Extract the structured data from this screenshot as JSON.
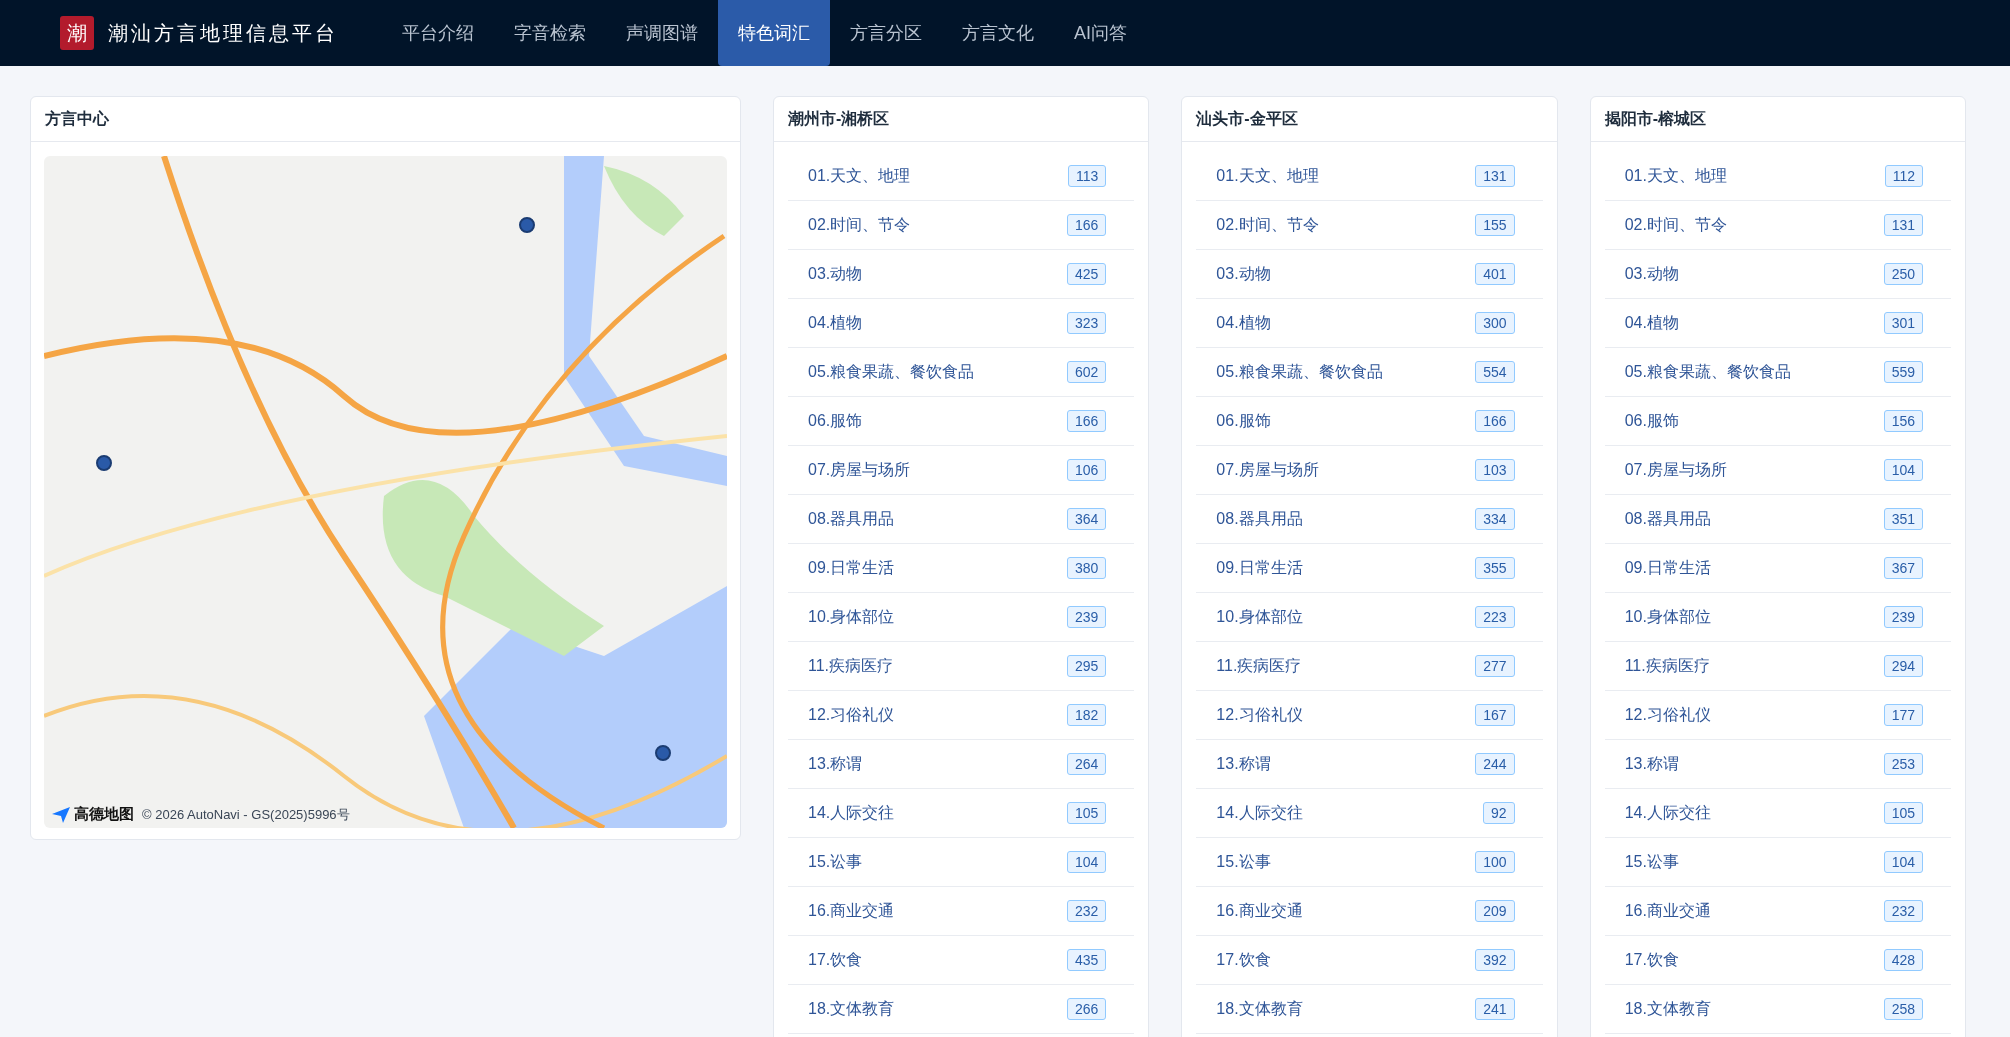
{
  "header": {
    "logo": "潮",
    "title": "潮汕方言地理信息平台",
    "nav": [
      {
        "label": "平台介绍",
        "selected": false
      },
      {
        "label": "字音检索",
        "selected": false
      },
      {
        "label": "声调图谱",
        "selected": false
      },
      {
        "label": "特色词汇",
        "selected": true
      },
      {
        "label": "方言分区",
        "selected": false
      },
      {
        "label": "方言文化",
        "selected": false
      },
      {
        "label": "AI问答",
        "selected": false
      }
    ]
  },
  "map_card": {
    "title": "方言中心",
    "map_logo": "高德地图",
    "attribution": "© 2026 AutoNavi - GS(2025)5996号"
  },
  "districts": [
    {
      "title": "潮州市-湘桥区",
      "items": [
        {
          "label": "01.天文、地理",
          "count": "113"
        },
        {
          "label": "02.时间、节令",
          "count": "166"
        },
        {
          "label": "03.动物",
          "count": "425"
        },
        {
          "label": "04.植物",
          "count": "323"
        },
        {
          "label": "05.粮食果蔬、餐饮食品",
          "count": "602"
        },
        {
          "label": "06.服饰",
          "count": "166"
        },
        {
          "label": "07.房屋与场所",
          "count": "106"
        },
        {
          "label": "08.器具用品",
          "count": "364"
        },
        {
          "label": "09.日常生活",
          "count": "380"
        },
        {
          "label": "10.身体部位",
          "count": "239"
        },
        {
          "label": "11.疾病医疗",
          "count": "295"
        },
        {
          "label": "12.习俗礼仪",
          "count": "182"
        },
        {
          "label": "13.称谓",
          "count": "264"
        },
        {
          "label": "14.人际交往",
          "count": "105"
        },
        {
          "label": "15.讼事",
          "count": "104"
        },
        {
          "label": "16.商业交通",
          "count": "232"
        },
        {
          "label": "17.饮食",
          "count": "435"
        },
        {
          "label": "18.文体教育",
          "count": "266"
        }
      ]
    },
    {
      "title": "汕头市-金平区",
      "items": [
        {
          "label": "01.天文、地理",
          "count": "131"
        },
        {
          "label": "02.时间、节令",
          "count": "155"
        },
        {
          "label": "03.动物",
          "count": "401"
        },
        {
          "label": "04.植物",
          "count": "300"
        },
        {
          "label": "05.粮食果蔬、餐饮食品",
          "count": "554"
        },
        {
          "label": "06.服饰",
          "count": "166"
        },
        {
          "label": "07.房屋与场所",
          "count": "103"
        },
        {
          "label": "08.器具用品",
          "count": "334"
        },
        {
          "label": "09.日常生活",
          "count": "355"
        },
        {
          "label": "10.身体部位",
          "count": "223"
        },
        {
          "label": "11.疾病医疗",
          "count": "277"
        },
        {
          "label": "12.习俗礼仪",
          "count": "167"
        },
        {
          "label": "13.称谓",
          "count": "244"
        },
        {
          "label": "14.人际交往",
          "count": "92"
        },
        {
          "label": "15.讼事",
          "count": "100"
        },
        {
          "label": "16.商业交通",
          "count": "209"
        },
        {
          "label": "17.饮食",
          "count": "392"
        },
        {
          "label": "18.文体教育",
          "count": "241"
        }
      ]
    },
    {
      "title": "揭阳市-榕城区",
      "items": [
        {
          "label": "01.天文、地理",
          "count": "112"
        },
        {
          "label": "02.时间、节令",
          "count": "131"
        },
        {
          "label": "03.动物",
          "count": "250"
        },
        {
          "label": "04.植物",
          "count": "301"
        },
        {
          "label": "05.粮食果蔬、餐饮食品",
          "count": "559"
        },
        {
          "label": "06.服饰",
          "count": "156"
        },
        {
          "label": "07.房屋与场所",
          "count": "104"
        },
        {
          "label": "08.器具用品",
          "count": "351"
        },
        {
          "label": "09.日常生活",
          "count": "367"
        },
        {
          "label": "10.身体部位",
          "count": "239"
        },
        {
          "label": "11.疾病医疗",
          "count": "294"
        },
        {
          "label": "12.习俗礼仪",
          "count": "177"
        },
        {
          "label": "13.称谓",
          "count": "253"
        },
        {
          "label": "14.人际交往",
          "count": "105"
        },
        {
          "label": "15.讼事",
          "count": "104"
        },
        {
          "label": "16.商业交通",
          "count": "232"
        },
        {
          "label": "17.饮食",
          "count": "428"
        },
        {
          "label": "18.文体教育",
          "count": "258"
        }
      ]
    }
  ]
}
